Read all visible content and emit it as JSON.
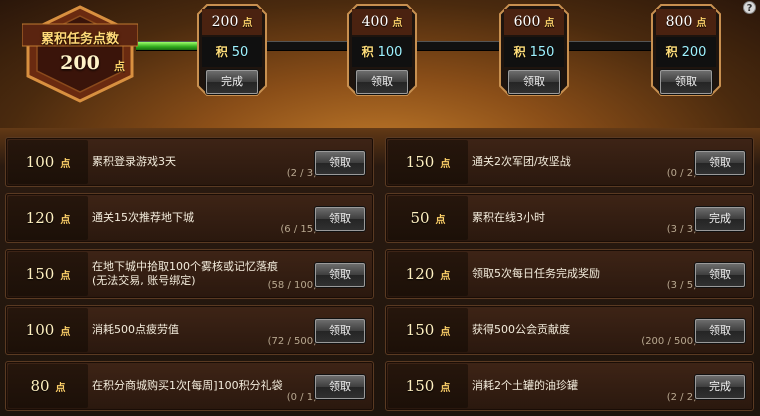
{
  "header": {
    "help_glyph": "?",
    "total_label": "累积任务点数",
    "total_value": "200",
    "unit": "点",
    "progress_fraction": 0.11
  },
  "milestones": [
    {
      "points": "200",
      "reward_label": "积",
      "reward": "50",
      "button": "完成"
    },
    {
      "points": "400",
      "reward_label": "积",
      "reward": "100",
      "button": "领取"
    },
    {
      "points": "600",
      "reward_label": "积",
      "reward": "150",
      "button": "领取"
    },
    {
      "points": "800",
      "reward_label": "积",
      "reward": "200",
      "button": "领取"
    }
  ],
  "quests": [
    {
      "points": "100",
      "desc": "累积登录游戏3天",
      "desc2": "",
      "progress": "(2 / 3)",
      "button": "领取"
    },
    {
      "points": "150",
      "desc": "通关2次军团/攻坚战",
      "desc2": "",
      "progress": "(0 / 2)",
      "button": "领取"
    },
    {
      "points": "120",
      "desc": "通关15次推荐地下城",
      "desc2": "",
      "progress": "(6 / 15)",
      "button": "领取"
    },
    {
      "points": "50",
      "desc": "累积在线3小时",
      "desc2": "",
      "progress": "(3 / 3)",
      "button": "完成"
    },
    {
      "points": "150",
      "desc": "在地下城中拾取100个雾核或记忆落痕",
      "desc2": "(无法交易, 账号绑定)",
      "progress": "(58 / 100)",
      "button": "领取"
    },
    {
      "points": "120",
      "desc": "领取5次每日任务完成奖励",
      "desc2": "",
      "progress": "(3 / 5)",
      "button": "领取"
    },
    {
      "points": "100",
      "desc": "消耗500点疲劳值",
      "desc2": "",
      "progress": "(72 / 500)",
      "button": "领取"
    },
    {
      "points": "150",
      "desc": "获得500公会贡献度",
      "desc2": "",
      "progress": "(200 / 500)",
      "button": "领取"
    },
    {
      "points": "80",
      "desc": "在积分商城购买1次[每周]100积分礼袋",
      "desc2": "",
      "progress": "(0 / 1)",
      "button": "领取"
    },
    {
      "points": "150",
      "desc": "消耗2个土罐的油珍罐",
      "desc2": "",
      "progress": "(2 / 2)",
      "button": "完成"
    }
  ],
  "colors": {
    "accent_gold": "#ffd26a",
    "progress_green": "#2ea81c",
    "reward_cyan": "#9ef2ff"
  }
}
